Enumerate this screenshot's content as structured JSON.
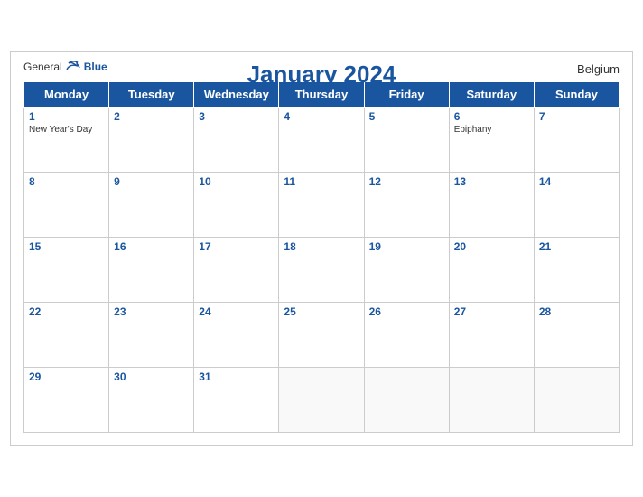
{
  "header": {
    "logo_general": "General",
    "logo_blue": "Blue",
    "title": "January 2024",
    "country": "Belgium"
  },
  "weekdays": [
    "Monday",
    "Tuesday",
    "Wednesday",
    "Thursday",
    "Friday",
    "Saturday",
    "Sunday"
  ],
  "weeks": [
    [
      {
        "day": "1",
        "holiday": "New Year's Day"
      },
      {
        "day": "2",
        "holiday": ""
      },
      {
        "day": "3",
        "holiday": ""
      },
      {
        "day": "4",
        "holiday": ""
      },
      {
        "day": "5",
        "holiday": ""
      },
      {
        "day": "6",
        "holiday": "Epiphany"
      },
      {
        "day": "7",
        "holiday": ""
      }
    ],
    [
      {
        "day": "8",
        "holiday": ""
      },
      {
        "day": "9",
        "holiday": ""
      },
      {
        "day": "10",
        "holiday": ""
      },
      {
        "day": "11",
        "holiday": ""
      },
      {
        "day": "12",
        "holiday": ""
      },
      {
        "day": "13",
        "holiday": ""
      },
      {
        "day": "14",
        "holiday": ""
      }
    ],
    [
      {
        "day": "15",
        "holiday": ""
      },
      {
        "day": "16",
        "holiday": ""
      },
      {
        "day": "17",
        "holiday": ""
      },
      {
        "day": "18",
        "holiday": ""
      },
      {
        "day": "19",
        "holiday": ""
      },
      {
        "day": "20",
        "holiday": ""
      },
      {
        "day": "21",
        "holiday": ""
      }
    ],
    [
      {
        "day": "22",
        "holiday": ""
      },
      {
        "day": "23",
        "holiday": ""
      },
      {
        "day": "24",
        "holiday": ""
      },
      {
        "day": "25",
        "holiday": ""
      },
      {
        "day": "26",
        "holiday": ""
      },
      {
        "day": "27",
        "holiday": ""
      },
      {
        "day": "28",
        "holiday": ""
      }
    ],
    [
      {
        "day": "29",
        "holiday": ""
      },
      {
        "day": "30",
        "holiday": ""
      },
      {
        "day": "31",
        "holiday": ""
      },
      {
        "day": "",
        "holiday": ""
      },
      {
        "day": "",
        "holiday": ""
      },
      {
        "day": "",
        "holiday": ""
      },
      {
        "day": "",
        "holiday": ""
      }
    ]
  ]
}
